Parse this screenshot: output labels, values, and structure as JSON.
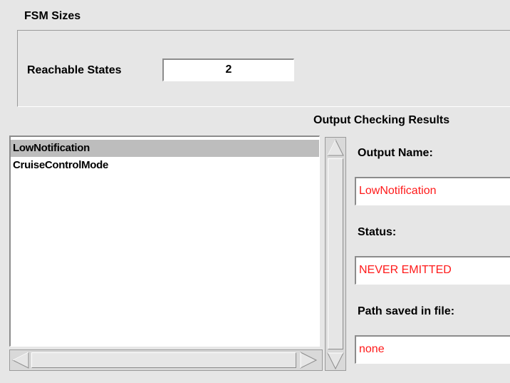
{
  "fsm_sizes": {
    "title": "FSM Sizes",
    "reachable_states_label": "Reachable States",
    "reachable_states_value": "2"
  },
  "output_checking": {
    "title": "Output Checking Results",
    "outputs": [
      "LowNotification",
      "CruiseControlMode"
    ],
    "selected_index": 0,
    "output_name_label": "Output Name:",
    "output_name_value": "LowNotification",
    "status_label": "Status:",
    "status_value": "NEVER EMITTED",
    "path_label": "Path saved in file:",
    "path_value": "none"
  },
  "colors": {
    "background": "#e6e6e6",
    "value_text": "#ff1a1a",
    "selection": "#bdbdbd"
  }
}
